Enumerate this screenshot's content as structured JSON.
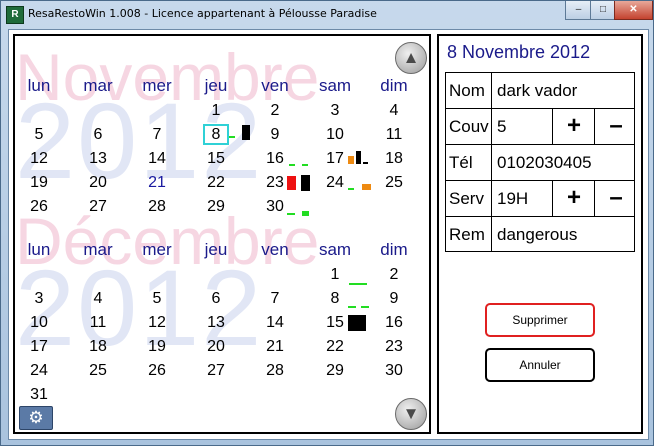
{
  "window": {
    "title": "ResaRestoWin 1.008 - Licence appartenant à Pélousse Paradise",
    "app_icon": "R",
    "minimize_label": "–",
    "maximize_label": "□",
    "close_label": "✕"
  },
  "calendar": {
    "day_headers": [
      "lun",
      "mar",
      "mer",
      "jeu",
      "ven",
      "sam",
      "dim"
    ],
    "months": [
      {
        "name": "Novembre",
        "year": "2012",
        "weeks": [
          [
            "",
            "",
            "",
            "1",
            "2",
            "3",
            "4"
          ],
          [
            "5",
            "6",
            "7",
            "8",
            "9",
            "10",
            "11"
          ],
          [
            "12",
            "13",
            "14",
            "15",
            "16",
            "17",
            "18"
          ],
          [
            "19",
            "20",
            "21",
            "22",
            "23",
            "24",
            "25"
          ],
          [
            "26",
            "27",
            "28",
            "29",
            "30",
            "",
            ""
          ]
        ],
        "today": "21",
        "selected": "8"
      },
      {
        "name": "Décembre",
        "year": "2012",
        "weeks": [
          [
            "",
            "",
            "",
            "",
            "",
            "1",
            "2"
          ],
          [
            "3",
            "4",
            "5",
            "6",
            "7",
            "8",
            "9"
          ],
          [
            "10",
            "11",
            "12",
            "13",
            "14",
            "15",
            "16"
          ],
          [
            "17",
            "18",
            "19",
            "20",
            "21",
            "22",
            "23"
          ],
          [
            "24",
            "25",
            "26",
            "27",
            "28",
            "29",
            "30"
          ],
          [
            "31",
            "",
            "",
            "",
            "",
            "",
            ""
          ]
        ]
      }
    ],
    "up_arrow": "▲",
    "down_arrow": "▼",
    "settings_icon": "⚙",
    "colors": {
      "accent": "#1a1a8a",
      "marker_green": "#22dd22",
      "marker_black": "#000000",
      "marker_red": "#ee1111",
      "marker_orange": "#ee8a11",
      "selected_border": "#2fd1d6"
    }
  },
  "form": {
    "date": "8 Novembre 2012",
    "name_label": "Nom",
    "name_value": "dark vador",
    "covers_label": "Couv",
    "covers_value": "5",
    "phone_label": "Tél",
    "phone_value": "0102030405",
    "service_label": "Serv",
    "service_value": "19H",
    "remark_label": "Rem",
    "remark_value": "dangerous",
    "plus": "+",
    "minus": "–",
    "delete_label": "Supprimer",
    "cancel_label": "Annuler"
  }
}
